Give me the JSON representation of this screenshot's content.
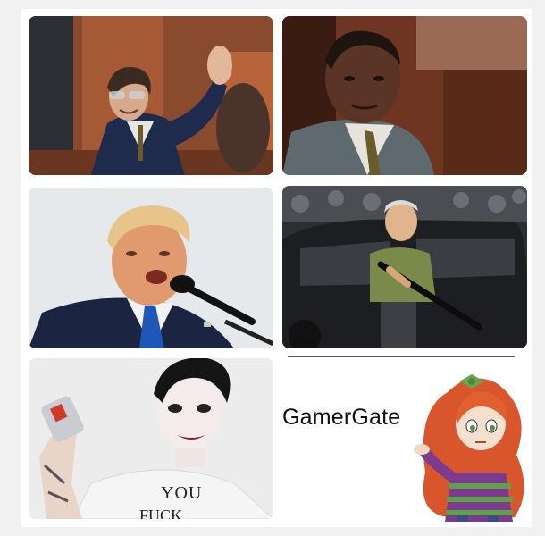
{
  "collage": {
    "tiles": [
      {
        "subject": "courtroom-wave"
      },
      {
        "subject": "courtroom-portrait"
      },
      {
        "subject": "podium-speaker"
      },
      {
        "subject": "street-night-rifle"
      },
      {
        "subject": "rocker-soda-can",
        "shirt_text_1": "YOU",
        "shirt_text_2": "FUCK"
      },
      {
        "subject": "gamergate-cartoon",
        "caption": "GamerGate"
      }
    ]
  }
}
